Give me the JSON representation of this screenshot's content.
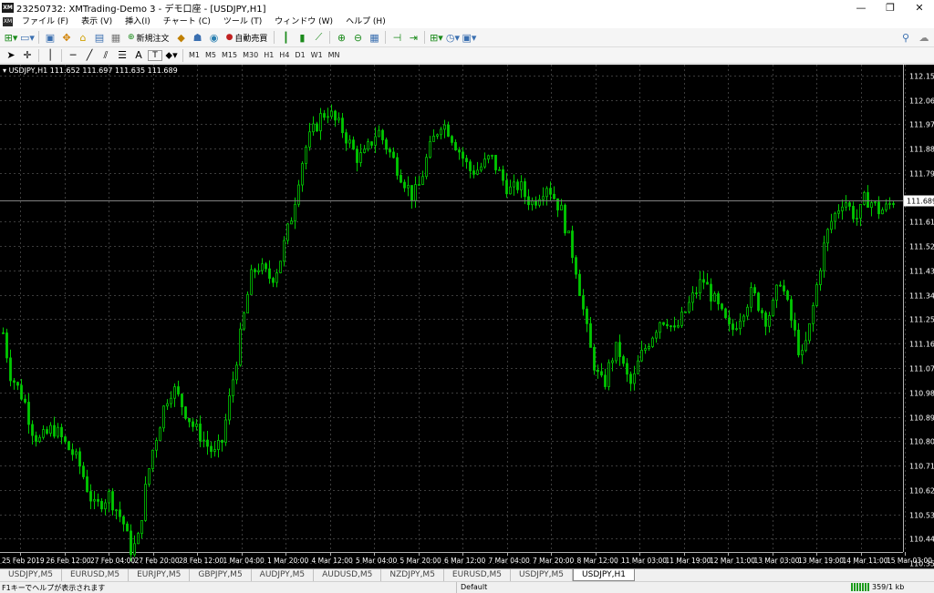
{
  "window": {
    "title": "23250732: XMTrading-Demo 3 - デモ口座 - [USDJPY,H1]",
    "app_icon": "XM",
    "minimize_glyph": "—",
    "restore_glyph": "❐",
    "close_glyph": "✕"
  },
  "menu": {
    "icon": "XM",
    "items": [
      "ファイル (F)",
      "表示 (V)",
      "挿入(I)",
      "チャート (C)",
      "ツール (T)",
      "ウィンドウ (W)",
      "ヘルプ (H)"
    ]
  },
  "toolbar": {
    "new_order_label": "新規注文",
    "auto_trade_label": "自動売買",
    "icons": [
      "new-chart-icon",
      "profiles-icon",
      "market-watch-icon",
      "data-window-icon",
      "navigator-icon",
      "terminal-icon",
      "strategy-tester-icon",
      "new-order-icon",
      "metaeditor-icon",
      "signals-icon",
      "auto-trading-icon",
      "bar-chart-icon",
      "candlestick-icon",
      "line-chart-icon",
      "zoom-in-icon",
      "zoom-out-icon",
      "tile-windows-icon",
      "chart-shift-icon",
      "autoscroll-icon",
      "indicators-icon",
      "periods-icon",
      "templates-icon",
      "search-icon",
      "chat-icon"
    ]
  },
  "toolbar2": {
    "text_tool": "A",
    "label_tool": "T",
    "timeframes": [
      "M1",
      "M5",
      "M15",
      "M30",
      "H1",
      "H4",
      "D1",
      "W1",
      "MN"
    ]
  },
  "chart": {
    "info": "USDJPY,H1  111.652 111.697 111.635 111.689",
    "current_price": "111.689",
    "colors": {
      "background": "#000000",
      "candle": "#00c800",
      "grid": "#3c3c3c",
      "price_line": "#808080",
      "axis_text": "#ffffff"
    },
    "price_labels": [
      "112.150",
      "112.060",
      "111.970",
      "111.880",
      "111.790",
      "111.610",
      "111.520",
      "111.430",
      "111.340",
      "111.250",
      "111.160",
      "111.070",
      "110.980",
      "110.890",
      "110.800",
      "110.710",
      "110.620",
      "110.530",
      "110.440",
      "110.350"
    ],
    "time_labels": [
      "25 Feb 2019",
      "26 Feb 12:00",
      "27 Feb 04:00",
      "27 Feb 20:00",
      "28 Feb 12:00",
      "1 Mar 04:00",
      "1 Mar 20:00",
      "4 Mar 12:00",
      "5 Mar 04:00",
      "5 Mar 20:00",
      "6 Mar 12:00",
      "7 Mar 04:00",
      "7 Mar 20:00",
      "8 Mar 12:00",
      "11 Mar 03:00",
      "11 Mar 19:00",
      "12 Mar 11:00",
      "13 Mar 03:00",
      "13 Mar 19:00",
      "14 Mar 11:00",
      "15 Mar 03:00"
    ]
  },
  "chart_data": {
    "type": "candlestick",
    "symbol": "USDJPY",
    "timeframe": "H1",
    "ylim": [
      110.33,
      112.19
    ],
    "close_path": [
      111.2,
      111.05,
      111.0,
      110.95,
      110.85,
      110.8,
      110.82,
      110.85,
      110.82,
      110.78,
      110.75,
      110.7,
      110.62,
      110.55,
      110.58,
      110.6,
      110.55,
      110.5,
      110.4,
      110.42,
      110.6,
      110.75,
      110.85,
      110.95,
      111.0,
      110.95,
      110.9,
      110.85,
      110.82,
      110.78,
      110.75,
      110.8,
      110.95,
      111.1,
      111.25,
      111.4,
      111.45,
      111.42,
      111.4,
      111.45,
      111.55,
      111.65,
      111.8,
      111.9,
      111.95,
      112.0,
      112.02,
      111.98,
      111.95,
      111.9,
      111.85,
      111.85,
      111.9,
      111.95,
      111.9,
      111.85,
      111.8,
      111.75,
      111.7,
      111.75,
      111.85,
      111.92,
      111.98,
      111.95,
      111.9,
      111.85,
      111.8,
      111.8,
      111.82,
      111.85,
      111.8,
      111.75,
      111.72,
      111.75,
      111.7,
      111.68,
      111.72,
      111.75,
      111.7,
      111.65,
      111.55,
      111.45,
      111.3,
      111.15,
      111.05,
      111.0,
      111.1,
      111.15,
      111.05,
      111.0,
      111.1,
      111.15,
      111.2,
      111.25,
      111.25,
      111.2,
      111.25,
      111.3,
      111.35,
      111.4,
      111.35,
      111.3,
      111.25,
      111.2,
      111.25,
      111.3,
      111.35,
      111.3,
      111.25,
      111.3,
      111.4,
      111.3,
      111.2,
      111.1,
      111.2,
      111.35,
      111.5,
      111.6,
      111.65,
      111.7,
      111.65,
      111.62,
      111.7,
      111.68,
      111.65,
      111.66,
      111.69
    ]
  }
}
